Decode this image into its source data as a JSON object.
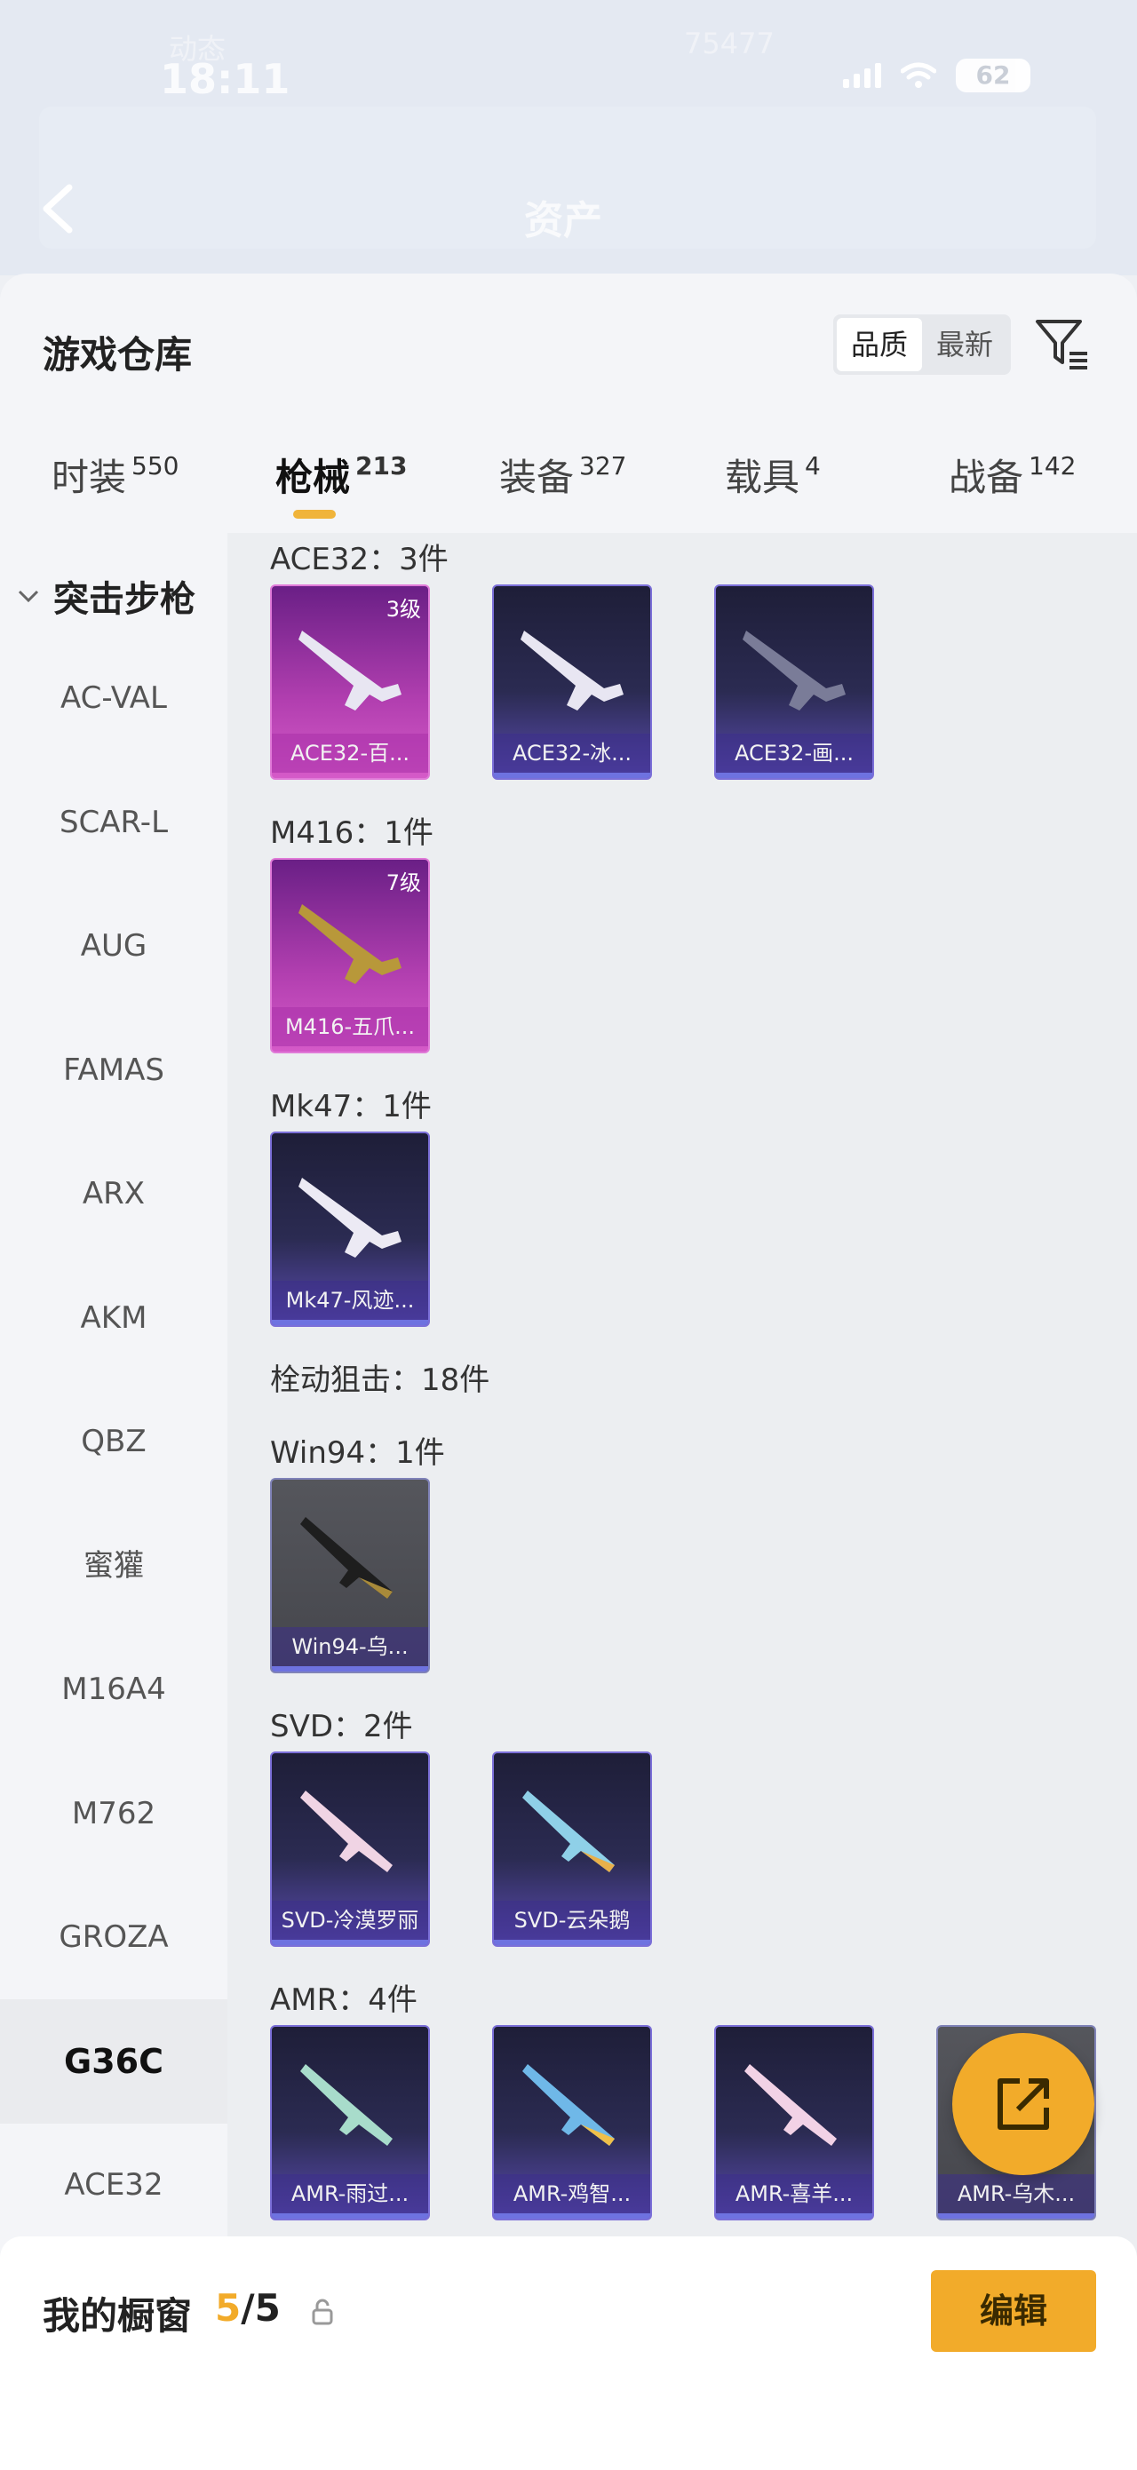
{
  "status": {
    "time": "18:11",
    "battery": "62",
    "faint_left": "动态",
    "faint_right": "75477"
  },
  "header": {
    "title": "资产"
  },
  "panel": {
    "title": "游戏仓库",
    "sort_options": [
      "品质",
      "最新"
    ],
    "sort_active": "品质"
  },
  "tabs": [
    {
      "label": "时装",
      "count": "550"
    },
    {
      "label": "枪械",
      "count": "213"
    },
    {
      "label": "装备",
      "count": "327"
    },
    {
      "label": "载具",
      "count": "4"
    },
    {
      "label": "战备",
      "count": "142"
    }
  ],
  "active_tab": "枪械",
  "sidebar": {
    "group": "突击步枪",
    "items": [
      "AC-VAL",
      "SCAR-L",
      "AUG",
      "FAMAS",
      "ARX",
      "AKM",
      "QBZ",
      "蜜獾",
      "M16A4",
      "M762",
      "GROZA",
      "G36C",
      "ACE32"
    ],
    "active": "G36C"
  },
  "content": {
    "groups": [
      {
        "label": "ACE32：3件",
        "items": [
          {
            "name": "ACE32-百...",
            "level": "3级",
            "rarity": "pink"
          },
          {
            "name": "ACE32-冰...",
            "level": "",
            "rarity": "purple"
          },
          {
            "name": "ACE32-画...",
            "level": "",
            "rarity": "purple"
          }
        ]
      },
      {
        "label": "M416：1件",
        "items": [
          {
            "name": "M416-五爪...",
            "level": "7级",
            "rarity": "pink"
          }
        ]
      },
      {
        "label": "Mk47：1件",
        "items": [
          {
            "name": "Mk47-风迹...",
            "level": "",
            "rarity": "purple"
          }
        ]
      },
      {
        "label": "栓动狙击：18件",
        "items": []
      },
      {
        "label": "Win94：1件",
        "items": [
          {
            "name": "Win94-乌...",
            "level": "",
            "rarity": "gray"
          }
        ]
      },
      {
        "label": "SVD：2件",
        "items": [
          {
            "name": "SVD-冷漠罗丽",
            "level": "",
            "rarity": "purple"
          },
          {
            "name": "SVD-云朵鹅",
            "level": "",
            "rarity": "purple"
          }
        ]
      },
      {
        "label": "AMR：4件",
        "items": [
          {
            "name": "AMR-雨过...",
            "level": "",
            "rarity": "purple"
          },
          {
            "name": "AMR-鸡智...",
            "level": "",
            "rarity": "purple"
          },
          {
            "name": "AMR-喜羊...",
            "level": "",
            "rarity": "purple"
          },
          {
            "name": "AMR-乌木...",
            "level": "",
            "rarity": "gray"
          }
        ]
      }
    ]
  },
  "bottom": {
    "title": "我的橱窗",
    "count_used": "5",
    "count_total": "/5",
    "edit_label": "编辑"
  },
  "colors": {
    "accent": "#f2ab2a",
    "legendary": "#c44bbd",
    "epic": "#5a4bb0"
  }
}
